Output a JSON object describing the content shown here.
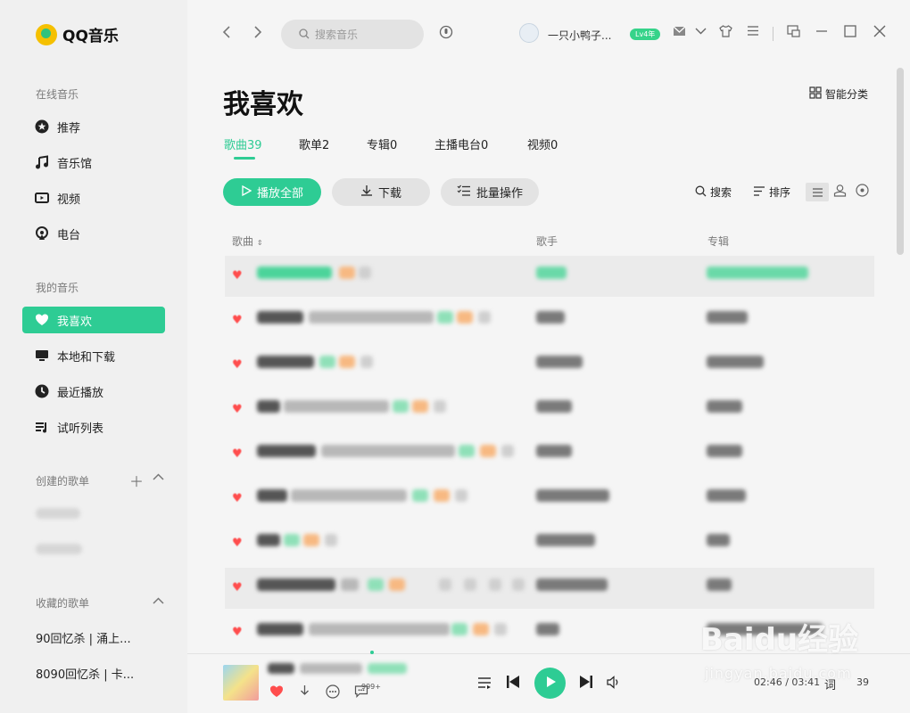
{
  "app": {
    "name": "QQ音乐"
  },
  "sidebar": {
    "online_title": "在线音乐",
    "online_items": [
      {
        "label": "推荐",
        "icon": "star-icon"
      },
      {
        "label": "音乐馆",
        "icon": "music-note-icon"
      },
      {
        "label": "视频",
        "icon": "video-icon"
      },
      {
        "label": "电台",
        "icon": "radio-icon"
      }
    ],
    "my_title": "我的音乐",
    "my_items": [
      {
        "label": "我喜欢",
        "icon": "heart-icon"
      },
      {
        "label": "本地和下载",
        "icon": "monitor-icon"
      },
      {
        "label": "最近播放",
        "icon": "clock-icon"
      },
      {
        "label": "试听列表",
        "icon": "playlist-icon"
      }
    ],
    "created_title": "创建的歌单",
    "collected_title": "收藏的歌单",
    "collected_items": [
      "90回忆杀 | 涌上...",
      "8090回忆杀 | 卡..."
    ]
  },
  "topbar": {
    "search_placeholder": "搜索音乐",
    "user_name": "一只小鸭子...",
    "vip_level": "Lv4年"
  },
  "main": {
    "title": "我喜欢",
    "smart_category": "智能分类",
    "tabs": [
      {
        "label": "歌曲39"
      },
      {
        "label": "歌单2"
      },
      {
        "label": "专辑0"
      },
      {
        "label": "主播电台0"
      },
      {
        "label": "视频0"
      }
    ],
    "actions": {
      "play_all": "播放全部",
      "download": "下载",
      "batch": "批量操作",
      "search": "搜索",
      "sort": "排序"
    },
    "columns": {
      "song": "歌曲",
      "artist": "歌手",
      "album": "专辑"
    }
  },
  "player": {
    "comment_count": "999+",
    "time": "02:46 / 03:41",
    "lyric_label": "词",
    "playlist_count": "39"
  },
  "watermark": {
    "main": "Baidu经验",
    "sub": "jingyan.baidu.com"
  },
  "colors": {
    "accent": "#2ecc94",
    "heart": "#ff4d4d"
  }
}
